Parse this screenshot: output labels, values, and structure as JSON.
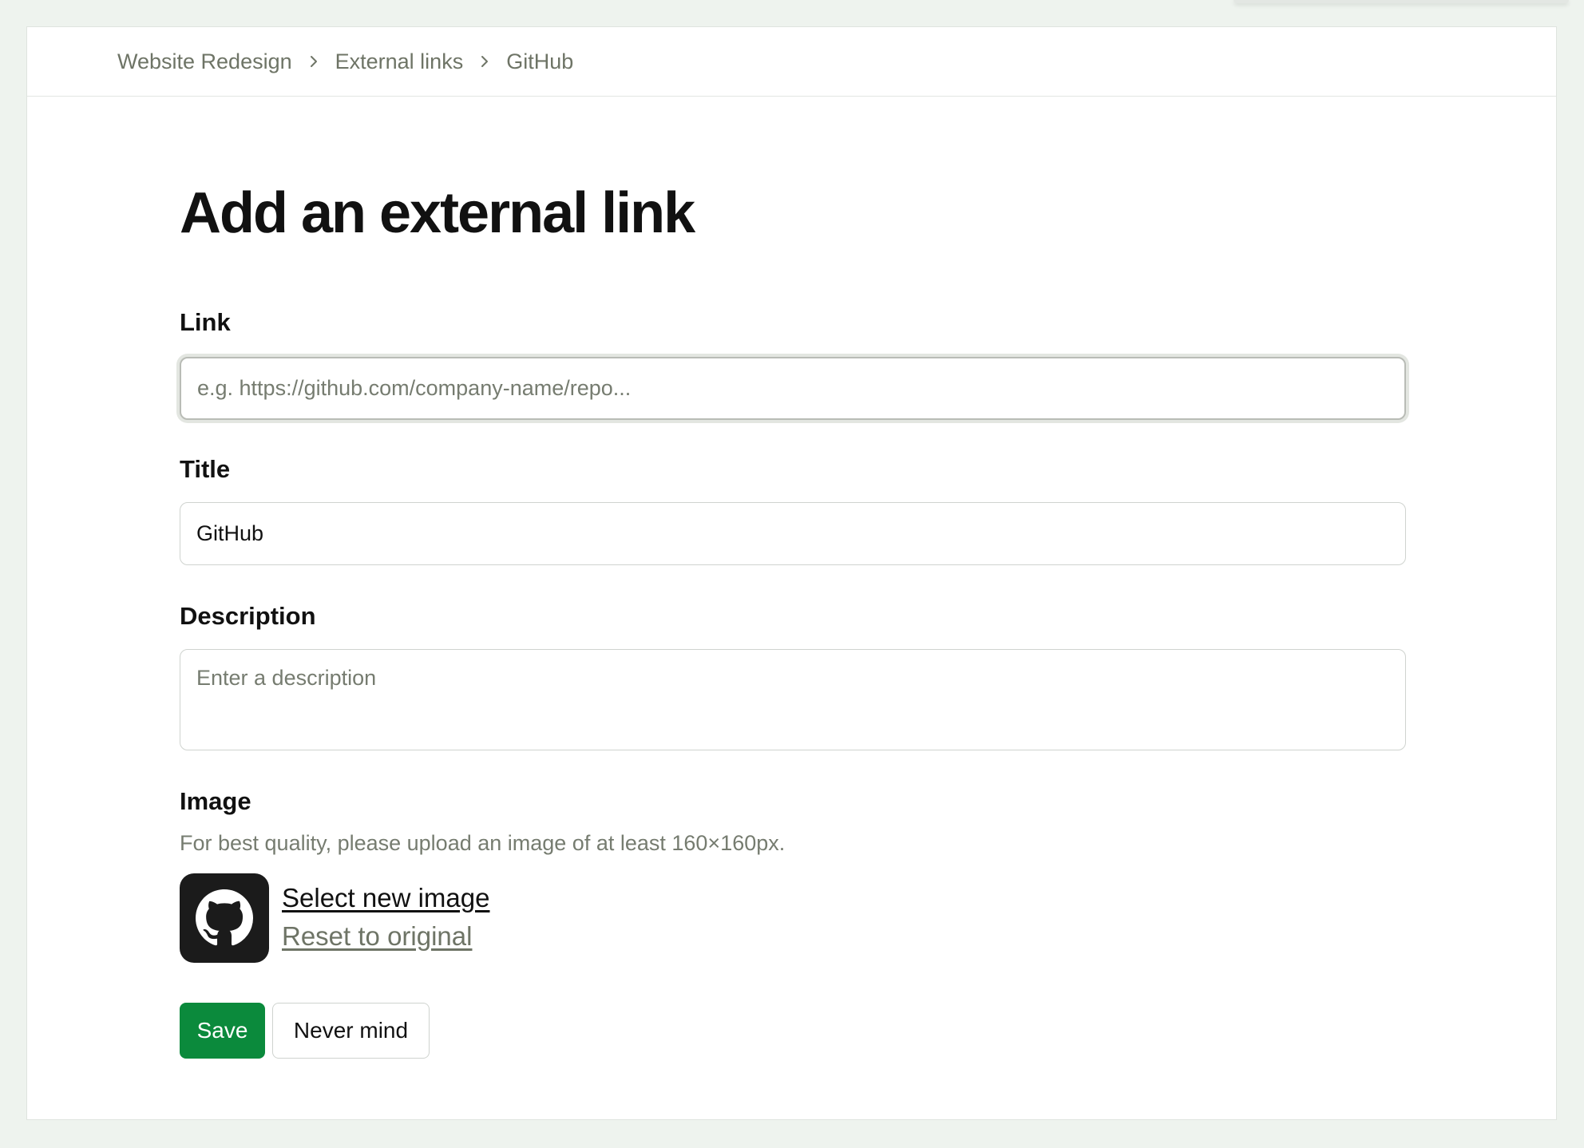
{
  "breadcrumb": {
    "items": [
      "Website Redesign",
      "External links",
      "GitHub"
    ]
  },
  "page": {
    "title": "Add an external link"
  },
  "form": {
    "link": {
      "label": "Link",
      "value": "",
      "placeholder": "e.g. https://github.com/company-name/repo..."
    },
    "title": {
      "label": "Title",
      "value": "GitHub",
      "placeholder": ""
    },
    "description": {
      "label": "Description",
      "value": "",
      "placeholder": "Enter a description"
    },
    "image": {
      "label": "Image",
      "hint": "For best quality, please upload an image of at least 160×160px.",
      "icon": "github-logo-icon",
      "select_label": "Select new image",
      "reset_label": "Reset to original"
    }
  },
  "actions": {
    "save_label": "Save",
    "cancel_label": "Never mind"
  },
  "colors": {
    "primary": "#0b8a3c",
    "background": "#eef3ee",
    "muted_text": "#6e7466"
  }
}
